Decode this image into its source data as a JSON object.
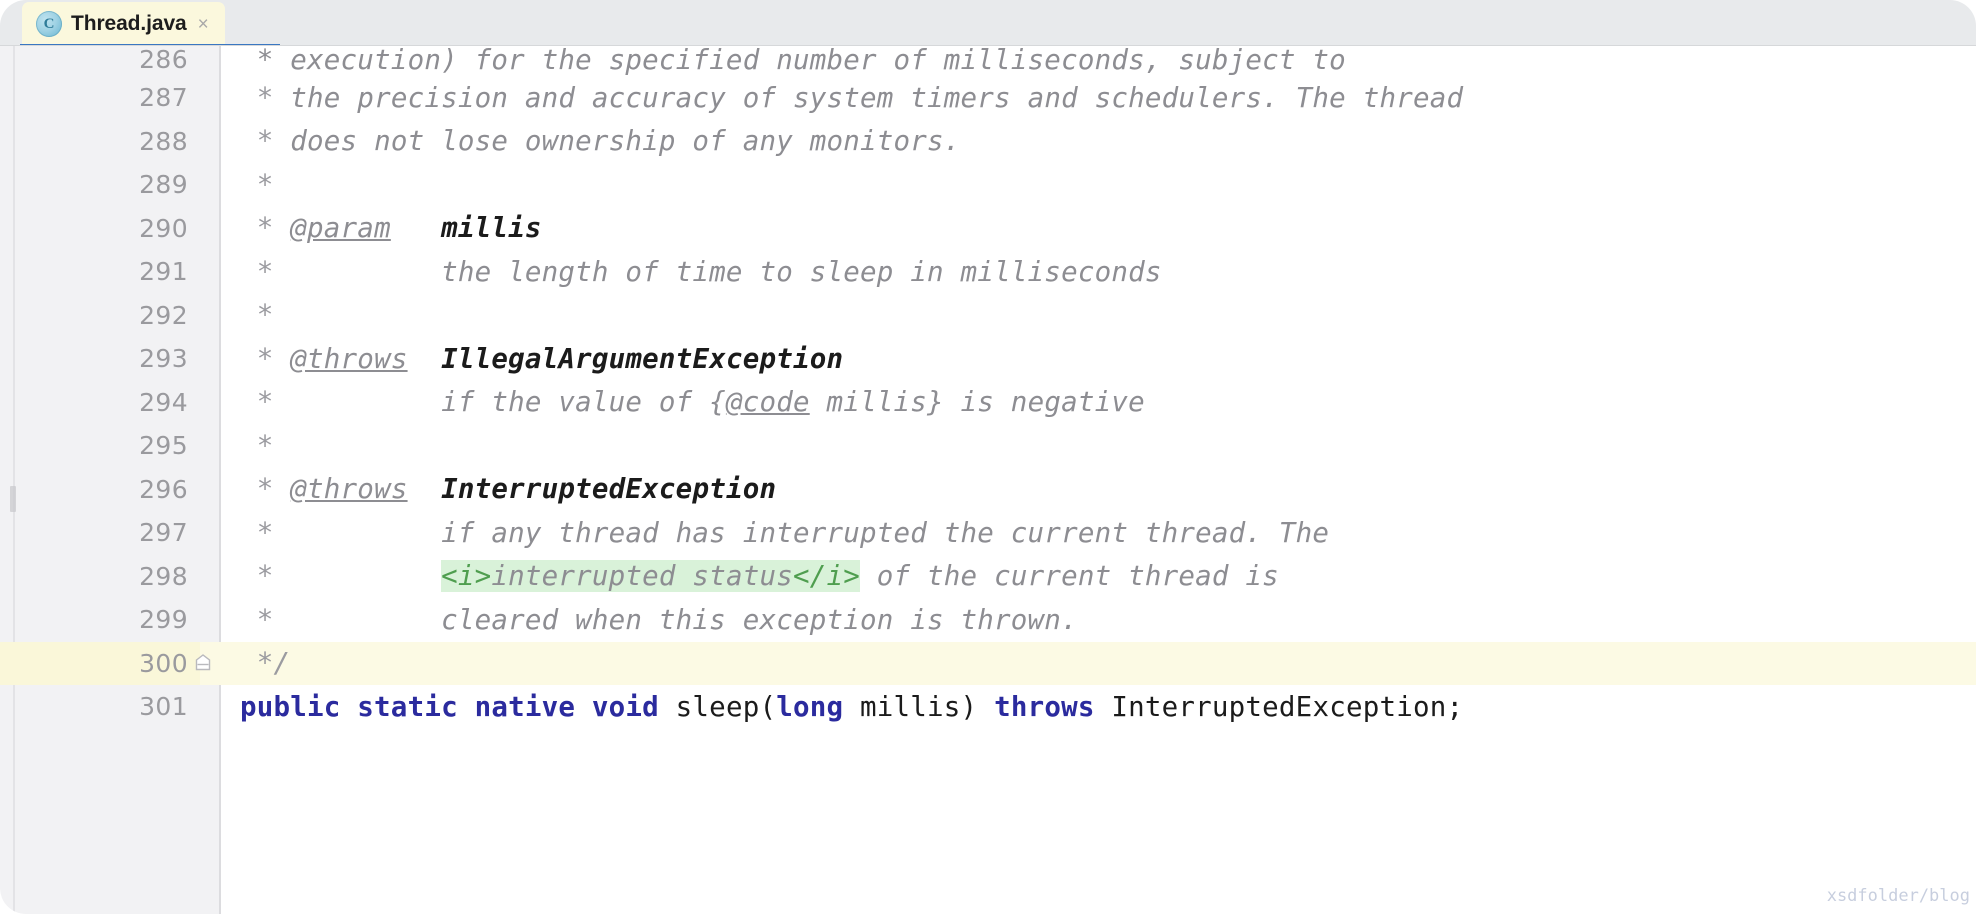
{
  "window": {
    "app": "IntelliJ IDEA Editor",
    "colors": {
      "tab_active_bg": "#fbf8dd",
      "tab_underline": "#3a77c2",
      "tabbar_bg": "#e8eaec",
      "gutter_bg": "#f2f2f4",
      "editor_bg": "#ffffff",
      "caret_line_bg": "#fcfae4",
      "comment_fg": "#8d8d92",
      "keyword_fg": "#2b2b9e",
      "html_tag_fg": "#4f9e4f",
      "html_tag_bg": "#d9f2d9",
      "line_number_fg": "#9a9a9e"
    }
  },
  "tabbar": {
    "tabs": [
      {
        "label": "Thread.java",
        "icon": "java-class-icon",
        "icon_glyph": "C",
        "close_glyph": "×",
        "active": true
      }
    ]
  },
  "editor": {
    "language": "Java",
    "fold_marker_glyph": "⌥",
    "watermark": "xsdfolder/blog",
    "lines": [
      {
        "number": "286",
        "clipped": true,
        "caret": false,
        "fold_end": false,
        "tokens": [
          {
            "text": " * execution) for the specified number of milliseconds, subject to",
            "type": "cmt"
          }
        ]
      },
      {
        "number": "287",
        "clipped": false,
        "caret": false,
        "fold_end": false,
        "tokens": [
          {
            "text": " * ",
            "type": "cmt-star"
          },
          {
            "text": "the precision and accuracy of system timers and schedulers. The thread",
            "type": "cmt"
          }
        ]
      },
      {
        "number": "288",
        "clipped": false,
        "caret": false,
        "fold_end": false,
        "tokens": [
          {
            "text": " * ",
            "type": "cmt-star"
          },
          {
            "text": "does not lose ownership of any monitors.",
            "type": "cmt"
          }
        ]
      },
      {
        "number": "289",
        "clipped": false,
        "caret": false,
        "fold_end": false,
        "tokens": [
          {
            "text": " *",
            "type": "cmt-star"
          }
        ]
      },
      {
        "number": "290",
        "clipped": false,
        "caret": false,
        "fold_end": false,
        "tokens": [
          {
            "text": " * ",
            "type": "cmt-star"
          },
          {
            "text": "@param",
            "type": "jd-tag"
          },
          {
            "text": "   ",
            "type": "cmt"
          },
          {
            "text": "millis",
            "type": "jd-val"
          }
        ]
      },
      {
        "number": "291",
        "clipped": false,
        "caret": false,
        "fold_end": false,
        "tokens": [
          {
            "text": " *          ",
            "type": "cmt-star"
          },
          {
            "text": "the length of time to sleep in milliseconds",
            "type": "cmt"
          }
        ]
      },
      {
        "number": "292",
        "clipped": false,
        "caret": false,
        "fold_end": false,
        "tokens": [
          {
            "text": " *",
            "type": "cmt-star"
          }
        ]
      },
      {
        "number": "293",
        "clipped": false,
        "caret": false,
        "fold_end": false,
        "tokens": [
          {
            "text": " * ",
            "type": "cmt-star"
          },
          {
            "text": "@throws",
            "type": "jd-tag"
          },
          {
            "text": "  ",
            "type": "cmt"
          },
          {
            "text": "IllegalArgumentException",
            "type": "jd-val"
          }
        ]
      },
      {
        "number": "294",
        "clipped": false,
        "caret": false,
        "fold_end": false,
        "tokens": [
          {
            "text": " *          ",
            "type": "cmt-star"
          },
          {
            "text": "if the value of {",
            "type": "cmt"
          },
          {
            "text": "@code",
            "type": "jd-inline"
          },
          {
            "text": " millis} is negative",
            "type": "cmt"
          }
        ]
      },
      {
        "number": "295",
        "clipped": false,
        "caret": false,
        "fold_end": false,
        "tokens": [
          {
            "text": " *",
            "type": "cmt-star"
          }
        ]
      },
      {
        "number": "296",
        "clipped": false,
        "caret": false,
        "fold_end": false,
        "tokens": [
          {
            "text": " * ",
            "type": "cmt-star"
          },
          {
            "text": "@throws",
            "type": "jd-tag"
          },
          {
            "text": "  ",
            "type": "cmt"
          },
          {
            "text": "InterruptedException",
            "type": "jd-val"
          }
        ]
      },
      {
        "number": "297",
        "clipped": false,
        "caret": false,
        "fold_end": false,
        "tokens": [
          {
            "text": " *          ",
            "type": "cmt-star"
          },
          {
            "text": "if any thread has interrupted the current thread. The",
            "type": "cmt"
          }
        ]
      },
      {
        "number": "298",
        "clipped": false,
        "caret": false,
        "fold_end": false,
        "tokens": [
          {
            "text": " *          ",
            "type": "cmt-star"
          },
          {
            "text": "<i>",
            "type": "html-tag"
          },
          {
            "text": "interrupted status",
            "type": "html-txt"
          },
          {
            "text": "</i>",
            "type": "html-tag"
          },
          {
            "text": " of the current thread is",
            "type": "cmt"
          }
        ]
      },
      {
        "number": "299",
        "clipped": false,
        "caret": false,
        "fold_end": false,
        "tokens": [
          {
            "text": " *          ",
            "type": "cmt-star"
          },
          {
            "text": "cleared when this exception is thrown.",
            "type": "cmt"
          }
        ]
      },
      {
        "number": "300",
        "clipped": false,
        "caret": true,
        "fold_end": true,
        "tokens": [
          {
            "text": " */",
            "type": "cmt-star"
          }
        ]
      },
      {
        "number": "301",
        "clipped": false,
        "caret": false,
        "fold_end": false,
        "tokens": [
          {
            "text": "public static native void ",
            "type": "kw"
          },
          {
            "text": "sleep(",
            "type": "plain"
          },
          {
            "text": "long",
            "type": "kw"
          },
          {
            "text": " millis) ",
            "type": "plain"
          },
          {
            "text": "throws",
            "type": "kw"
          },
          {
            "text": " InterruptedException;",
            "type": "plain"
          }
        ]
      }
    ]
  }
}
